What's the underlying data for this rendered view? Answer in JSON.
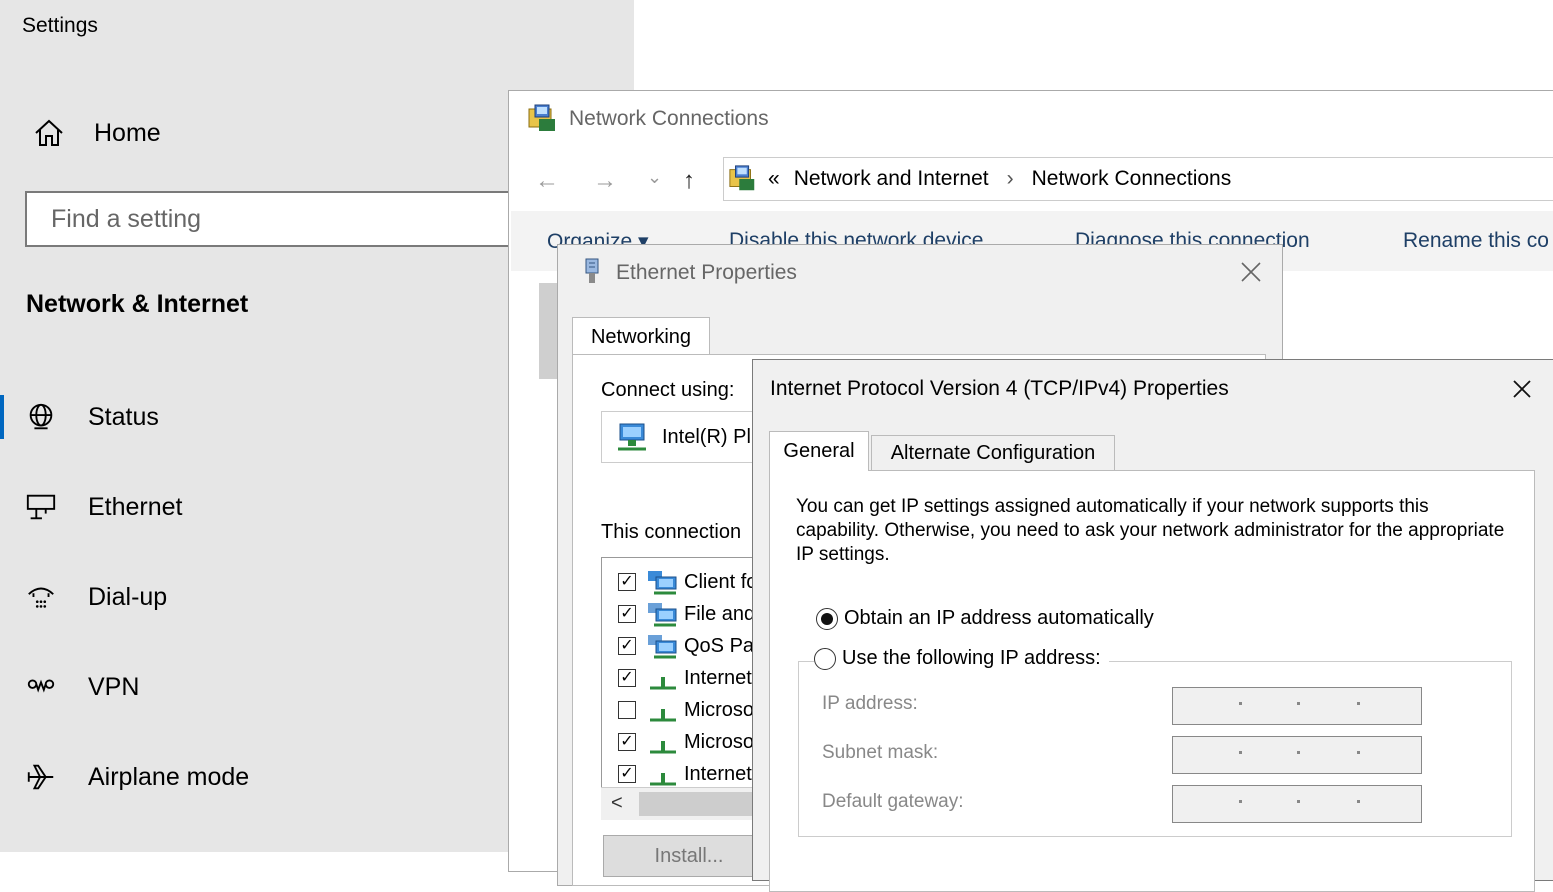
{
  "settings": {
    "title": "Settings",
    "home": "Home",
    "search_placeholder": "Find a setting",
    "section": "Network & Internet",
    "items": [
      {
        "label": "Status",
        "icon": "globe-icon"
      },
      {
        "label": "Ethernet",
        "icon": "ethernet-icon"
      },
      {
        "label": "Dial-up",
        "icon": "dialup-icon"
      },
      {
        "label": "VPN",
        "icon": "vpn-icon"
      },
      {
        "label": "Airplane mode",
        "icon": "airplane-icon"
      }
    ]
  },
  "network_connections": {
    "title": "Network Connections",
    "address": {
      "prefix": "«",
      "crumb1": "Network and Internet",
      "separator": "›",
      "crumb2": "Network Connections"
    },
    "nav": {
      "back": "←",
      "forward": "→",
      "recent": "⌄",
      "up": "↑"
    },
    "commands": {
      "organize": "Organize ▾",
      "disable": "Disable this network device",
      "diagnose": "Diagnose this connection",
      "rename": "Rename this co"
    }
  },
  "ethernet_properties": {
    "title": "Ethernet Properties",
    "tab": "Networking",
    "connect_using": "Connect using:",
    "adapter": "Intel(R) Pl",
    "this_connection": "This connection",
    "items": [
      {
        "label": "Client fo",
        "checked": true
      },
      {
        "label": "File and",
        "checked": true
      },
      {
        "label": "QoS Pa",
        "checked": true
      },
      {
        "label": "Internet",
        "checked": true
      },
      {
        "label": "Microso",
        "checked": false
      },
      {
        "label": "Microso",
        "checked": true
      },
      {
        "label": "Internet",
        "checked": true
      }
    ],
    "scroll_left": "<",
    "install": "Install..."
  },
  "ipv4": {
    "title": "Internet Protocol Version 4 (TCP/IPv4) Properties",
    "tab_general": "General",
    "tab_alternate": "Alternate Configuration",
    "description": "You can get IP settings assigned automatically if your network supports this capability. Otherwise, you need to ask your network administrator for the appropriate IP settings.",
    "obtain_auto": "Obtain an IP address automatically",
    "use_following": "Use the following IP address:",
    "selected": "obtain_auto",
    "ip_address_label": "IP address:",
    "subnet_mask_label": "Subnet mask:",
    "default_gateway_label": "Default gateway:"
  },
  "colors": {
    "accent": "#0067c0",
    "link": "#1e3f66"
  }
}
